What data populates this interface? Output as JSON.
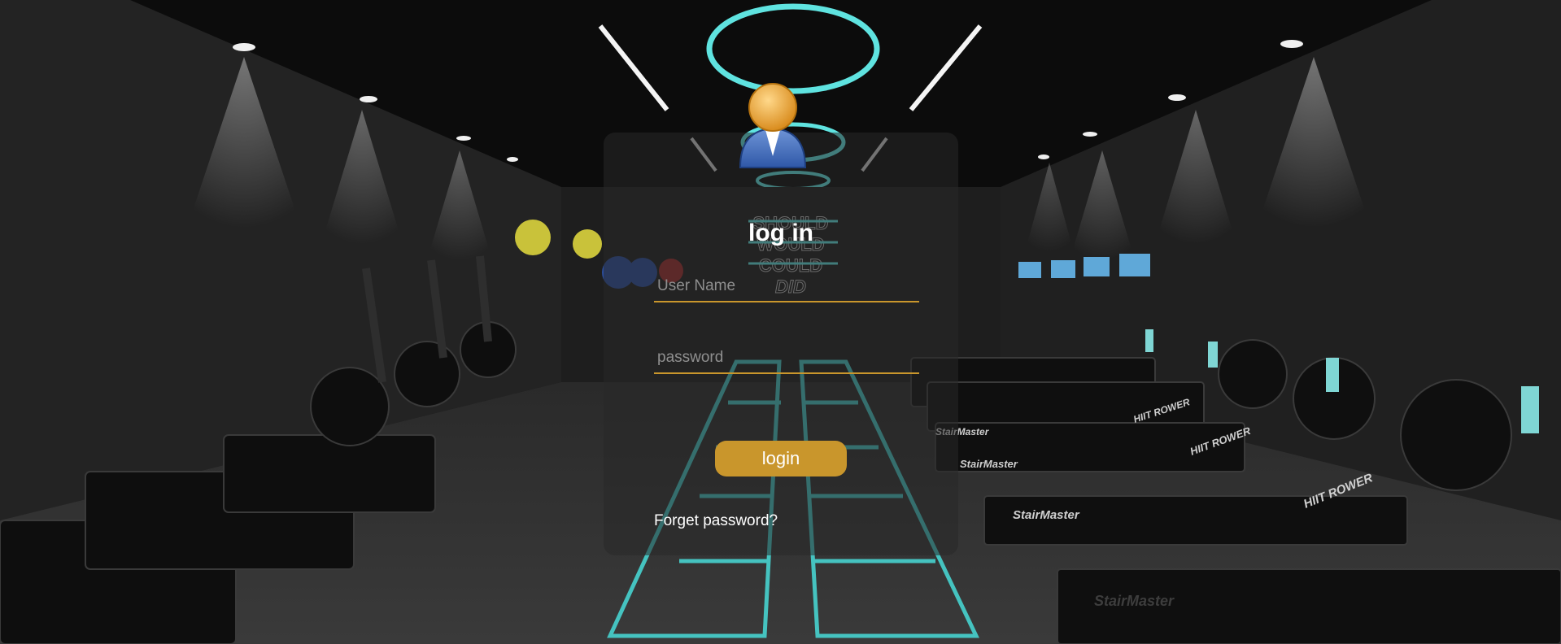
{
  "login": {
    "title": "log in",
    "username_placeholder": "User Name",
    "password_placeholder": "password",
    "submit_label": "login",
    "forgot_label": "Forget password?"
  },
  "background": {
    "sign_lines": [
      "SHOULD",
      "WOULD",
      "COULD",
      "DID"
    ],
    "equipment_brands": [
      "StairMaster",
      "HIIT ROWER"
    ]
  },
  "colors": {
    "accent": "#c9962c",
    "neon": "#5fe3e0",
    "card": "#282828",
    "text": "#ffffff"
  },
  "icons": [
    "user-avatar-icon"
  ]
}
